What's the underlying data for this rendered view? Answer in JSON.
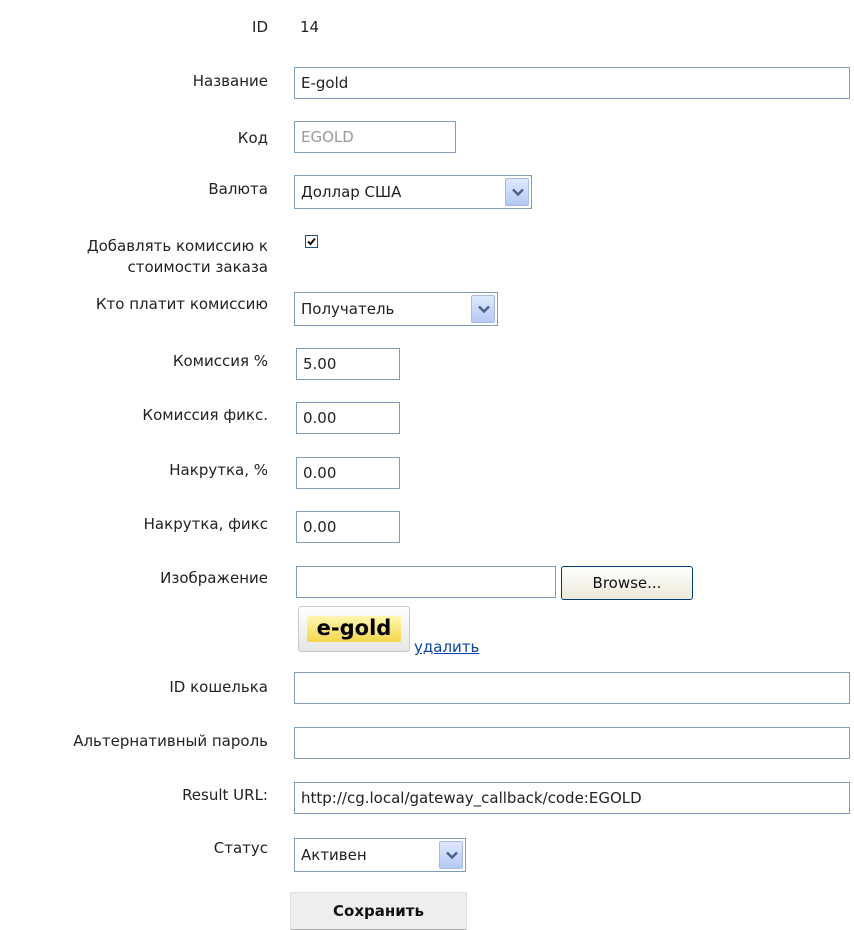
{
  "form": {
    "id": {
      "label": "ID",
      "value": "14"
    },
    "name": {
      "label": "Название",
      "value": "E-gold"
    },
    "code": {
      "label": "Код",
      "value": "EGOLD"
    },
    "currency": {
      "label": "Валюта",
      "selected": "Доллар США"
    },
    "add_commission": {
      "label_line1": "Добавлять комиссию к",
      "label_line2": "стоимости заказа",
      "checked": true
    },
    "who_pays": {
      "label": "Кто платит комиссию",
      "selected": "Получатель"
    },
    "commission_pct": {
      "label": "Комиссия %",
      "value": "5.00"
    },
    "commission_fixed": {
      "label": "Комиссия фикс.",
      "value": "0.00"
    },
    "markup_pct": {
      "label": "Накрутка, %",
      "value": "0.00"
    },
    "markup_fixed": {
      "label": "Накрутка, фикс",
      "value": "0.00"
    },
    "image": {
      "label": "Изображение",
      "browse_label": "Browse...",
      "logo_text": "e-gold",
      "delete_link": "удалить"
    },
    "wallet_id": {
      "label": "ID кошелька",
      "value": ""
    },
    "alt_password": {
      "label": "Альтернативный пароль",
      "value": ""
    },
    "result_url": {
      "label": "Result URL:",
      "value": "http://cg.local/gateway_callback/code:EGOLD"
    },
    "status": {
      "label": "Статус",
      "selected": "Активен"
    },
    "save_label": "Сохранить"
  },
  "icons": {
    "select_arrow": "chevron-down-icon",
    "checkbox": "checkmark-icon"
  }
}
